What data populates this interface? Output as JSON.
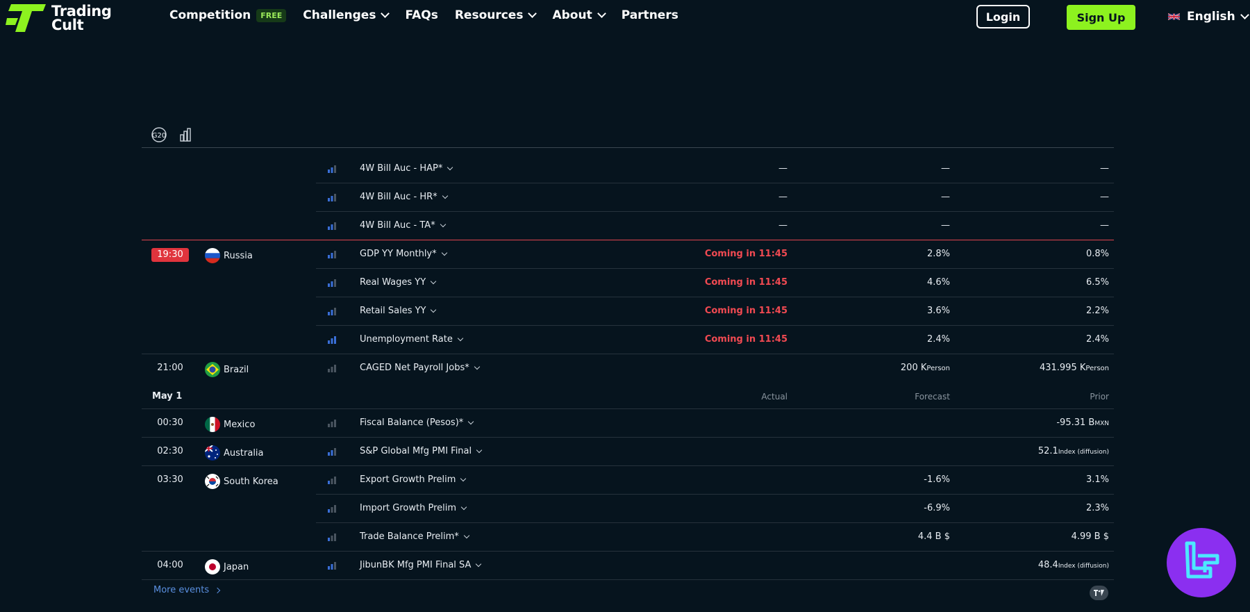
{
  "brand": {
    "name_line1": "Trading",
    "name_line2": "Cult",
    "accent": "#8df21f"
  },
  "nav": {
    "competition": "Competition",
    "free_badge": "FREE",
    "challenges": "Challenges",
    "faqs": "FAQs",
    "resources": "Resources",
    "about": "About",
    "partners": "Partners",
    "login": "Login",
    "signup": "Sign Up",
    "language": "English"
  },
  "toolbar": {
    "icons": [
      "g20-icon",
      "bar-chart-icon"
    ]
  },
  "table": {
    "headers": {
      "actual": "Actual",
      "forecast": "Forecast",
      "prior": "Prior"
    },
    "rows": [
      {
        "time": "",
        "country": "",
        "event": "4W Bill Auc - HAP*",
        "actual": "—",
        "forecast": "—",
        "prior": "—"
      },
      {
        "time": "",
        "country": "",
        "event": "4W Bill Auc - HR*",
        "actual": "—",
        "forecast": "—",
        "prior": "—"
      },
      {
        "time": "",
        "country": "",
        "event": "4W Bill Auc - TA*",
        "actual": "—",
        "forecast": "—",
        "prior": "—"
      },
      {
        "time": "19:30",
        "country": "Russia",
        "event": "GDP YY Monthly*",
        "actual": "Coming in 11:45",
        "forecast": "2.8%",
        "prior": "0.8%"
      },
      {
        "time": "",
        "country": "",
        "event": "Real Wages YY",
        "actual": "Coming in 11:45",
        "forecast": "4.6%",
        "prior": "6.5%"
      },
      {
        "time": "",
        "country": "",
        "event": "Retail Sales YY",
        "actual": "Coming in 11:45",
        "forecast": "3.6%",
        "prior": "2.2%"
      },
      {
        "time": "",
        "country": "",
        "event": "Unemployment Rate",
        "actual": "Coming in 11:45",
        "forecast": "2.4%",
        "prior": "2.4%"
      },
      {
        "time": "21:00",
        "country": "Brazil",
        "event": "CAGED Net Payroll Jobs*",
        "actual": "",
        "forecast": "200 K",
        "forecast_unit": "Person",
        "prior": "431.995 K",
        "prior_unit": "Person"
      },
      {
        "date": "May 1"
      },
      {
        "time": "00:30",
        "country": "Mexico",
        "event": "Fiscal Balance (Pesos)*",
        "actual": "",
        "forecast": "",
        "prior": "-95.31 B",
        "prior_unit": "MXN"
      },
      {
        "time": "02:30",
        "country": "Australia",
        "event": "S&P Global Mfg PMI Final",
        "actual": "",
        "forecast": "",
        "prior": "52.1",
        "prior_unit": "Index (diffusion)"
      },
      {
        "time": "03:30",
        "country": "South Korea",
        "event": "Export Growth Prelim",
        "actual": "",
        "forecast": "-1.6%",
        "prior": "3.1%"
      },
      {
        "time": "",
        "country": "",
        "event": "Import Growth Prelim",
        "actual": "",
        "forecast": "-6.9%",
        "prior": "2.3%"
      },
      {
        "time": "",
        "country": "",
        "event": "Trade Balance Prelim*",
        "actual": "",
        "forecast": "4.4 B $",
        "prior": "4.99 B $"
      },
      {
        "time": "04:00",
        "country": "Japan",
        "event": "JibunBK Mfg PMI Final SA",
        "actual": "",
        "forecast": "",
        "prior": "48.4",
        "prior_unit": "Index (diffusion)"
      }
    ]
  },
  "footer": {
    "more_events": "More events"
  },
  "colors": {
    "background": "#06141e",
    "live_red": "#e0343d",
    "link_blue": "#5a8fe0",
    "fab_purple": "#8b2ff0"
  }
}
